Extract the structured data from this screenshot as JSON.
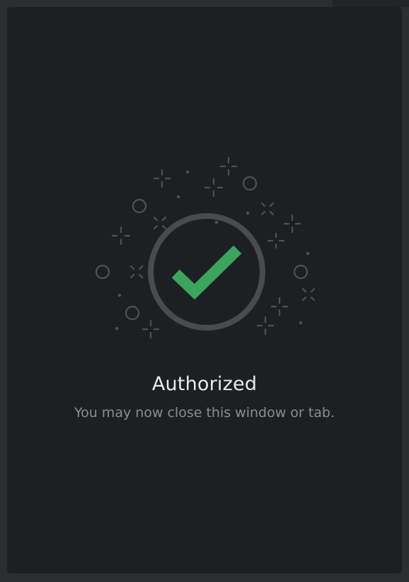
{
  "status": {
    "title": "Authorized",
    "message": "You may now close this window or tab."
  },
  "icon": {
    "name": "checkmark-icon",
    "accent_color": "#3ba55c",
    "ring_color": "#4a4b4f",
    "sparkle_color": "#4f5155"
  }
}
